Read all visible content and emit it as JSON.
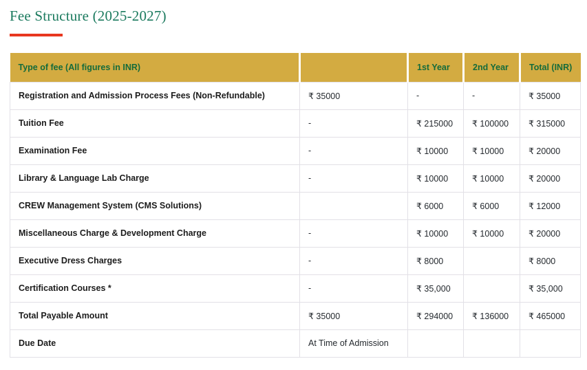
{
  "page": {
    "title": "Fee Structure (2025-2027)"
  },
  "fee_table": {
    "headers": [
      "Type of fee (All figures in INR)",
      "",
      "1st Year",
      "2nd Year",
      "Total (INR)"
    ],
    "rows": [
      {
        "cells": [
          "Registration and Admission Process Fees (Non-Refundable)",
          "₹ 35000",
          "-",
          "-",
          "₹ 35000"
        ]
      },
      {
        "cells": [
          "Tuition Fee",
          "-",
          "₹ 215000",
          "₹ 100000",
          "₹ 315000"
        ]
      },
      {
        "cells": [
          "Examination Fee",
          "-",
          "₹ 10000",
          "₹ 10000",
          "₹ 20000"
        ]
      },
      {
        "cells": [
          "Library & Language Lab Charge",
          "-",
          "₹ 10000",
          "₹ 10000",
          "₹ 20000"
        ]
      },
      {
        "cells": [
          "CREW Management System (CMS Solutions)",
          "",
          "₹ 6000",
          "₹ 6000",
          "₹ 12000"
        ]
      },
      {
        "cells": [
          "Miscellaneous Charge & Development Charge",
          "-",
          "₹ 10000",
          "₹ 10000",
          "₹ 20000"
        ]
      },
      {
        "cells": [
          "Executive Dress Charges",
          "-",
          "₹ 8000",
          "",
          "₹ 8000"
        ]
      },
      {
        "cells": [
          "Certification Courses *",
          "-",
          "₹ 35,000",
          "",
          "₹ 35,000"
        ]
      },
      {
        "cells": [
          "Total Payable Amount",
          "₹ 35000",
          "₹ 294000",
          "₹ 136000",
          "₹ 465000"
        ]
      },
      {
        "cells": [
          "Due Date",
          "At Time of Admission",
          "",
          "",
          ""
        ]
      }
    ]
  },
  "colors": {
    "header_background_gold": "#d3ab41",
    "header_text_green": "#156b3b",
    "title_green": "#1b7a5e",
    "accent_underline_red": "#e8371f",
    "row_border_gray": "#e2e0e6"
  }
}
